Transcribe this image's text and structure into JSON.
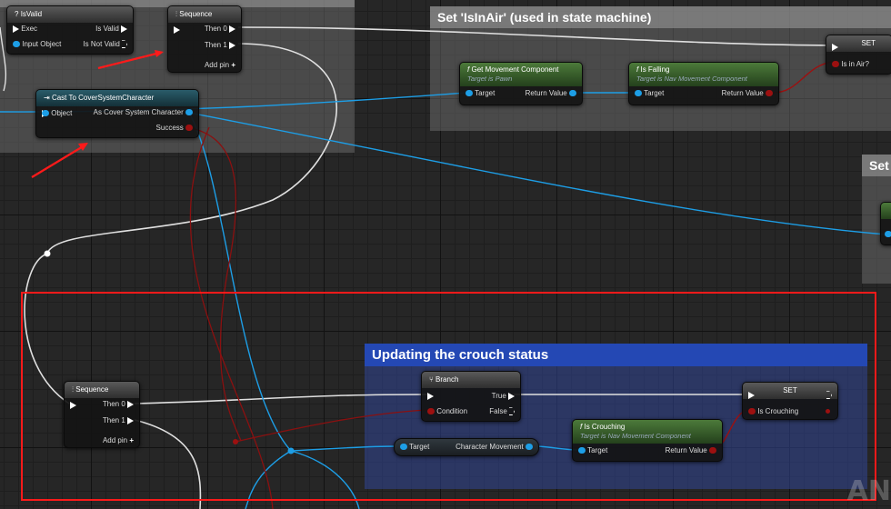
{
  "comments": {
    "top_left_hidden": "",
    "is_in_air": "Set 'IsInAir' (used in state machine)",
    "right_partial": "Set",
    "crouch": "Updating the crouch status"
  },
  "nodes": {
    "is_valid": {
      "title": "IsValid",
      "icon": "question-icon",
      "exec": "Exec",
      "input_object": "Input Object",
      "is_valid": "Is Valid",
      "is_not_valid": "Is Not Valid"
    },
    "sequence_top": {
      "title": "Sequence",
      "then0": "Then 0",
      "then1": "Then 1",
      "add_pin": "Add pin"
    },
    "cast": {
      "title": "Cast To CoverSystemCharacter",
      "object": "Object",
      "as_char": "As Cover System Character",
      "success": "Success"
    },
    "get_movement": {
      "title": "Get Movement Component",
      "subtitle": "Target is Pawn",
      "target": "Target",
      "return": "Return Value"
    },
    "is_falling": {
      "title": "Is Falling",
      "subtitle": "Target is Nav Movement Component",
      "target": "Target",
      "return": "Return Value"
    },
    "set_air": {
      "title": "SET",
      "pin": "Is in Air?"
    },
    "sequence_bottom": {
      "title": "Sequence",
      "then0": "Then 0",
      "then1": "Then 1",
      "add_pin": "Add pin"
    },
    "branch": {
      "title": "Branch",
      "condition": "Condition",
      "true": "True",
      "false": "False"
    },
    "char_movement": {
      "target": "Target",
      "label": "Character Movement"
    },
    "is_crouching": {
      "title": "Is Crouching",
      "subtitle": "Target is Nav Movement Component",
      "target": "Target",
      "return": "Return Value"
    },
    "set_crouch": {
      "title": "SET",
      "pin": "Is Crouching"
    }
  },
  "watermark": "AN",
  "colors": {
    "exec_wire": "#e8e8e8",
    "object_wire": "#1d9ee6",
    "bool_wire": "#9c1010",
    "highlight": "#ff1a1a"
  }
}
